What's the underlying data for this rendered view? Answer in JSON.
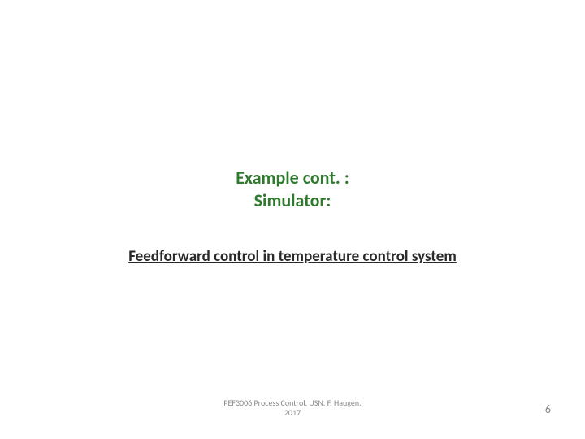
{
  "title": {
    "line1": "Example cont. :",
    "line2": "Simulator:"
  },
  "link": {
    "text": "Feedforward control in temperature control system"
  },
  "footer": {
    "line1": "PEF3006 Process Control. USN. F. Haugen.",
    "line2": "2017"
  },
  "page_number": "6"
}
